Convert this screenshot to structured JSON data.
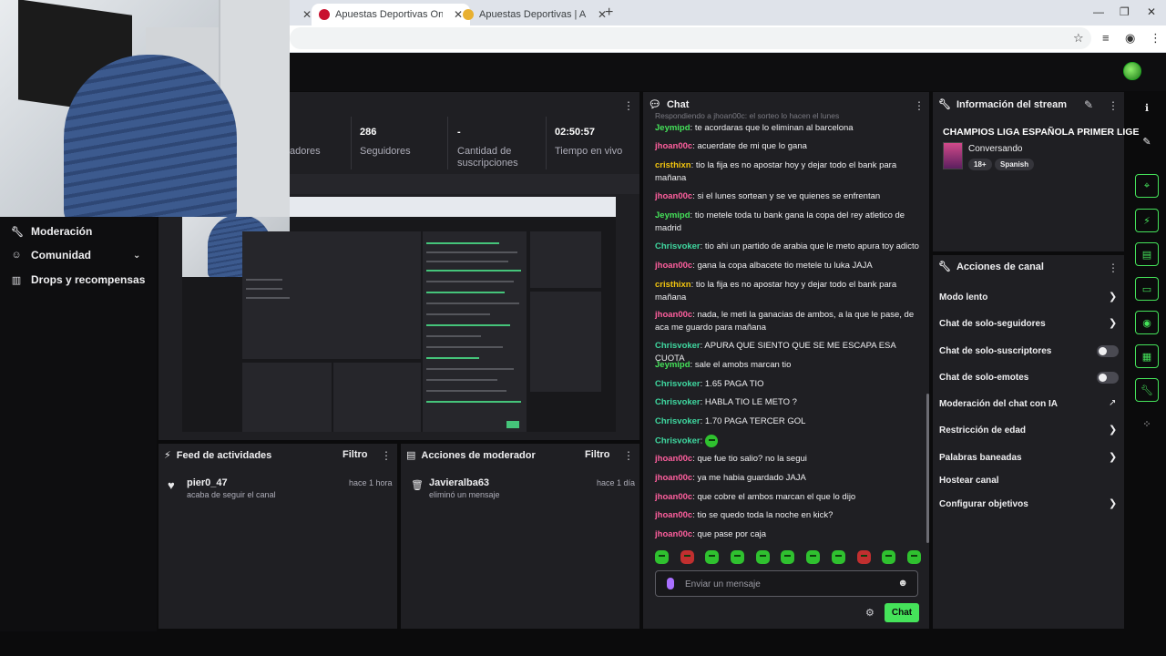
{
  "browser": {
    "tabs": [
      {
        "title": "Apuestas Deportivas Online | Ap"
      },
      {
        "title": "Apuestas Deportivas | Apuestas"
      }
    ]
  },
  "sidebar": {
    "items": [
      {
        "label": "Moderación",
        "icon": "wrench-icon"
      },
      {
        "label": "Comunidad",
        "icon": "people-icon"
      },
      {
        "label": "Drops y recompensas",
        "icon": "gift-icon"
      }
    ]
  },
  "stats": {
    "viewers_label": "adores",
    "followers_value": "286",
    "followers_label": "Seguidores",
    "subs_value": "-",
    "subs_label_1": "Cantidad de",
    "subs_label_2": "suscripciones",
    "time_value": "02:50:57",
    "time_label": "Tiempo en vivo"
  },
  "activity_feed": {
    "title": "Feed de actividades",
    "filter": "Filtro",
    "user": "pier0_47",
    "action": "acaba de seguir el canal",
    "time": "hace 1 hora"
  },
  "mod_actions": {
    "title": "Acciones de moderador",
    "filter": "Filtro",
    "user": "Javieralba63",
    "action": "eliminó un mensaje",
    "time": "hace 1 día"
  },
  "chat": {
    "title": "Chat",
    "reply_note": "Respondiendo a jhoan00c: el sorteo lo hacen el lunes",
    "messages": [
      {
        "user": "Jeymipd",
        "color": "#45e35a",
        "text": "te acordaras que lo eliminan al barcelona"
      },
      {
        "user": "jhoan00c",
        "color": "#ff5f9e",
        "text": "acuerdate de mi que lo gana"
      },
      {
        "user": "cristhixn",
        "color": "#f1c40f",
        "text": "tio la fija es no apostar hoy y dejar todo el bank para mañana"
      },
      {
        "user": "jhoan00c",
        "color": "#ff5f9e",
        "text": "si el lunes sortean y se ve quienes se enfrentan"
      },
      {
        "user": "Jeymipd",
        "color": "#45e35a",
        "text": "tio metele toda tu bank gana la copa del rey atletico de madrid"
      },
      {
        "user": "Chrisvoker",
        "color": "#3fd8a0",
        "text": "tio ahi un partido de arabia que le meto apura toy adicto"
      },
      {
        "user": "jhoan00c",
        "color": "#ff5f9e",
        "text": "gana la copa albacete tio metele tu luka JAJA"
      },
      {
        "user": "cristhixn",
        "color": "#f1c40f",
        "text": "tio la fija es no apostar hoy y dejar todo el bank para mañana"
      },
      {
        "user": "jhoan00c",
        "color": "#ff5f9e",
        "text": "nada, le meti la ganacias de ambos, a la que le pase, de aca me guardo para mañana"
      },
      {
        "user": "Chrisvoker",
        "color": "#3fd8a0",
        "text": "APURA QUE SIENTO QUE SE ME ESCAPA ESA CUOTA"
      },
      {
        "user": "Jeymipd",
        "color": "#45e35a",
        "text": "sale el amobs marcan tio"
      },
      {
        "user": "Chrisvoker",
        "color": "#3fd8a0",
        "text": "1.65 PAGA TIO"
      },
      {
        "user": "Chrisvoker",
        "color": "#3fd8a0",
        "text": "HABLA TIO LE METO ?"
      },
      {
        "user": "Chrisvoker",
        "color": "#3fd8a0",
        "text": "1.70 PAGA TERCER GOL"
      },
      {
        "user": "Chrisvoker",
        "color": "#3fd8a0",
        "text": ""
      },
      {
        "user": "jhoan00c",
        "color": "#ff5f9e",
        "text": "que fue tio salio? no la segui"
      },
      {
        "user": "jhoan00c",
        "color": "#ff5f9e",
        "text": "ya me habia guardado JAJA"
      },
      {
        "user": "jhoan00c",
        "color": "#ff5f9e",
        "text": "que cobre el ambos marcan el que lo dijo"
      },
      {
        "user": "jhoan00c",
        "color": "#ff5f9e",
        "text": "tio se quedo toda la noche en kick?"
      },
      {
        "user": "jhoan00c",
        "color": "#ff5f9e",
        "text": "que pase por caja"
      }
    ],
    "input_placeholder": "Enviar un mensaje",
    "send_label": "Chat"
  },
  "stream_info": {
    "title": "Información del stream",
    "stream_title": "CHAMPIOS LIGA ESPAÑOLA PRIMER LIGE",
    "category": "Conversando",
    "tag_age": "18+",
    "tag_lang": "Spanish"
  },
  "channel_actions": {
    "title": "Acciones de canal",
    "items": [
      {
        "label": "Modo lento",
        "control": "arrow"
      },
      {
        "label": "Chat de solo-seguidores",
        "control": "arrow"
      },
      {
        "label": "Chat de solo-suscriptores",
        "control": "toggle"
      },
      {
        "label": "Chat de solo-emotes",
        "control": "toggle"
      },
      {
        "label": "Moderación del chat con IA",
        "control": "external"
      },
      {
        "label": "Restricción de edad",
        "control": "arrow"
      },
      {
        "label": "Palabras baneadas",
        "control": "arrow"
      },
      {
        "label": "Hostear canal",
        "control": "none"
      },
      {
        "label": "Configurar objetivos",
        "control": "arrow"
      }
    ]
  },
  "colors": {
    "accent": "#45e35a",
    "panel": "#1f1f23",
    "background": "#0b0b0c"
  }
}
